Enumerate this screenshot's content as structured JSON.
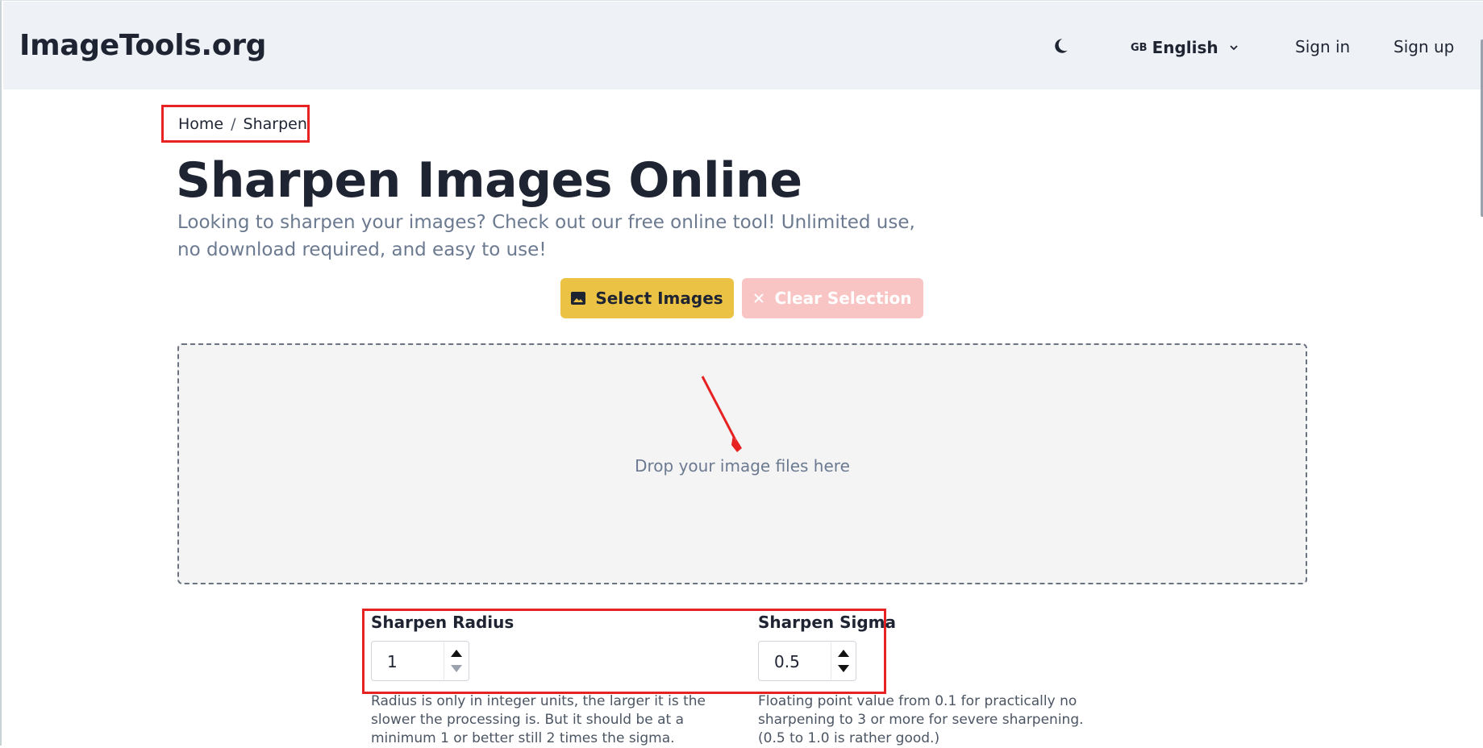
{
  "header": {
    "logo": "ImageTools.org",
    "theme_icon": "moon-icon",
    "language": {
      "flag": "GB",
      "label": "English"
    },
    "sign_in": "Sign in",
    "sign_up": "Sign up"
  },
  "breadcrumb": {
    "home": "Home",
    "separator": "/",
    "current": "Sharpen"
  },
  "page": {
    "title": "Sharpen Images Online",
    "subtitle": "Looking to sharpen your images? Check out our free online tool! Unlimited use, no download required, and easy to use!"
  },
  "actions": {
    "select_label": "Select Images",
    "clear_label": "Clear Selection"
  },
  "dropzone": {
    "text": "Drop your image files here"
  },
  "options": {
    "radius": {
      "label": "Sharpen Radius",
      "value": "1",
      "help": "Radius is only in integer units, the larger it is the slower the processing is. But it should be at a minimum 1 or better still 2 times the sigma."
    },
    "sigma": {
      "label": "Sharpen Sigma",
      "value": "0.5",
      "help": "Floating point value from 0.1 for practically no sharpening to 3 or more for severe sharpening. (0.5 to 1.0 is rather good.)"
    }
  },
  "colors": {
    "accent": "#ebc244",
    "clear_button": "#f8c4c4",
    "annotation_red": "#e62222",
    "header_bg": "#eef2f6"
  }
}
